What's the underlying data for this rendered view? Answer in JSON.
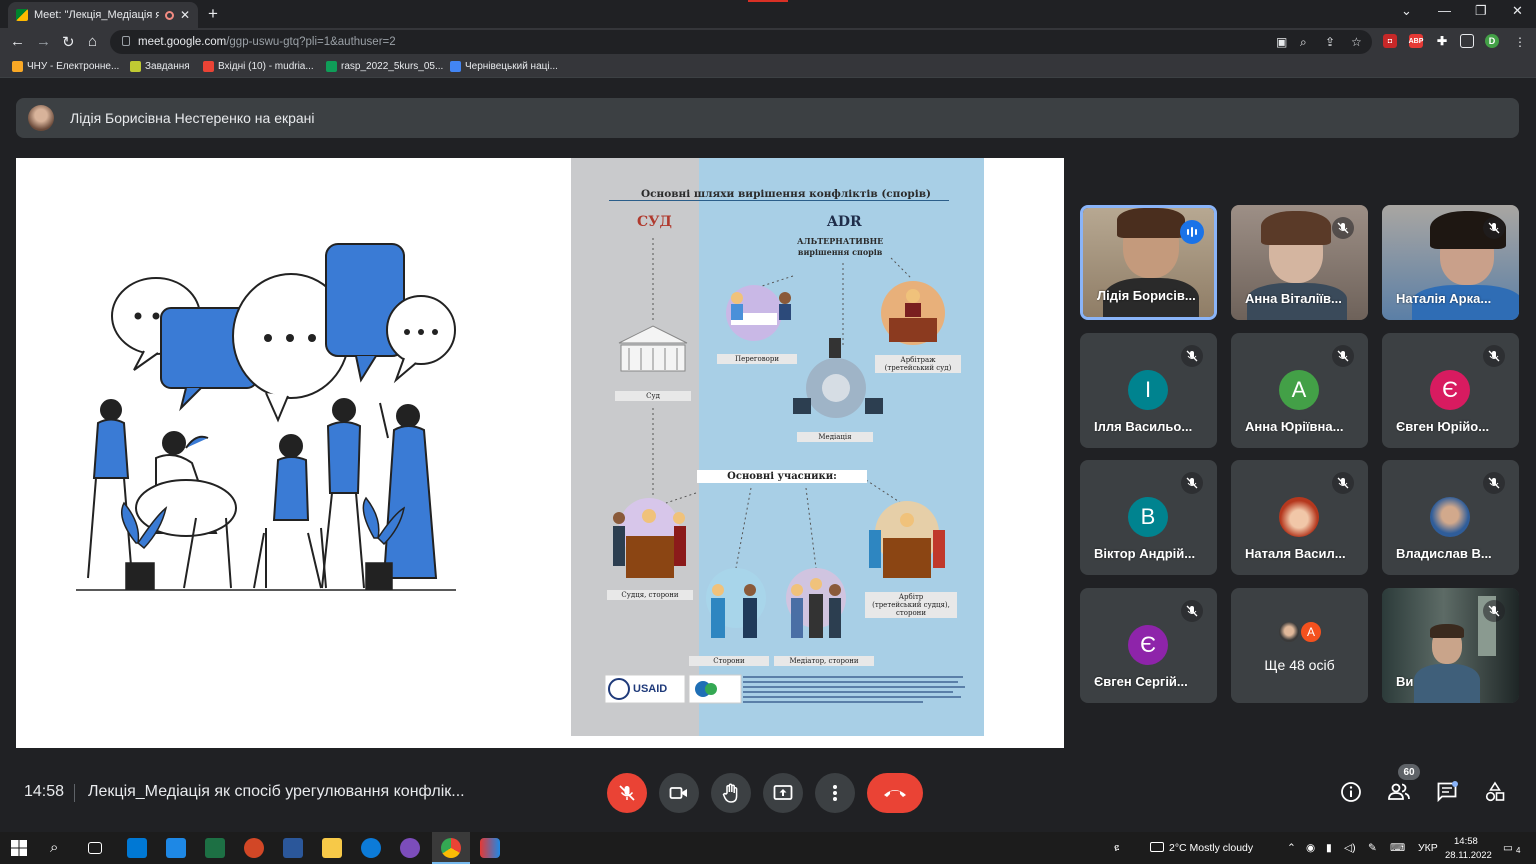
{
  "browser": {
    "tab_title": "Meet: \"Лекція_Медіація як с",
    "url_domain": "meet.google.com",
    "url_path": "/ggp-uswu-gtq?pli=1&authuser=2",
    "profile_initial": "D",
    "bookmarks": [
      {
        "label": "ЧНУ - Електронне...",
        "color": "#f9a825"
      },
      {
        "label": "Завдання",
        "color": "#c0ca33"
      },
      {
        "label": "Вхідні (10) - mudria...",
        "color": "#ea4335"
      },
      {
        "label": "rasp_2022_5kurs_05...",
        "color": "#0f9d58"
      },
      {
        "label": "Чернівецький наці...",
        "color": "#4285f4"
      }
    ]
  },
  "meet": {
    "presenter_text": "Лідія Борисівна Нестеренко на екрані",
    "clock": "14:58",
    "meeting_title": "Лекція_Медіація як спосіб урегулювання конфлік...",
    "participants_count": "60",
    "tiles": [
      {
        "name": "Лідія Борисів...",
        "kind": "video",
        "speaking": true
      },
      {
        "name": "Анна Віталіїв...",
        "kind": "video"
      },
      {
        "name": "Наталія Арка...",
        "kind": "video"
      },
      {
        "name": "Ілля Васильо...",
        "initial": "І",
        "color": "#00838f"
      },
      {
        "name": "Анна Юріївна...",
        "initial": "А",
        "color": "#43a047"
      },
      {
        "name": "Євген Юрійо...",
        "initial": "Є",
        "color": "#d81b60"
      },
      {
        "name": "Віктор Андрій...",
        "initial": "В",
        "color": "#00838f"
      },
      {
        "name": "Наталя Васил...",
        "kind": "photo"
      },
      {
        "name": "Владислав В...",
        "kind": "photo"
      },
      {
        "name": "Євген Сергій...",
        "initial": "Є",
        "color": "#8e24aa"
      },
      {
        "name": "Ще 48 осіб",
        "kind": "more",
        "initial": "А"
      },
      {
        "name": "Ви",
        "kind": "video"
      }
    ]
  },
  "slide": {
    "heading": "Основні шляхи вирішення конфліктів (спорів)",
    "left_title": "СУД",
    "right_title": "ADR",
    "adr_subtitle": "АЛЬТЕРНАТИВНЕ\nвирішення спорів",
    "labels": {
      "court": "Суд",
      "negotiations": "Переговори",
      "arbitration": "Арбітраж\n(третейський суд)",
      "mediation": "Медіація",
      "participants": "Основні учасники:",
      "judge_parties": "Судця, сторони",
      "parties": "Сторони",
      "mediator_parties": "Медіатор, сторони",
      "arbiter": "Арбітр\n(третейський судця),\nсторони"
    },
    "logo": "USAID"
  },
  "taskbar": {
    "weather": "2°C  Mostly cloudy",
    "lang": "УКР",
    "time": "14:58",
    "date": "28.11.2022",
    "notifications": "4"
  },
  "colors": {
    "meet_bg": "#202124",
    "tile_bg": "#3c4043",
    "accent_blue": "#3a7bd5",
    "danger": "#ea4335"
  }
}
